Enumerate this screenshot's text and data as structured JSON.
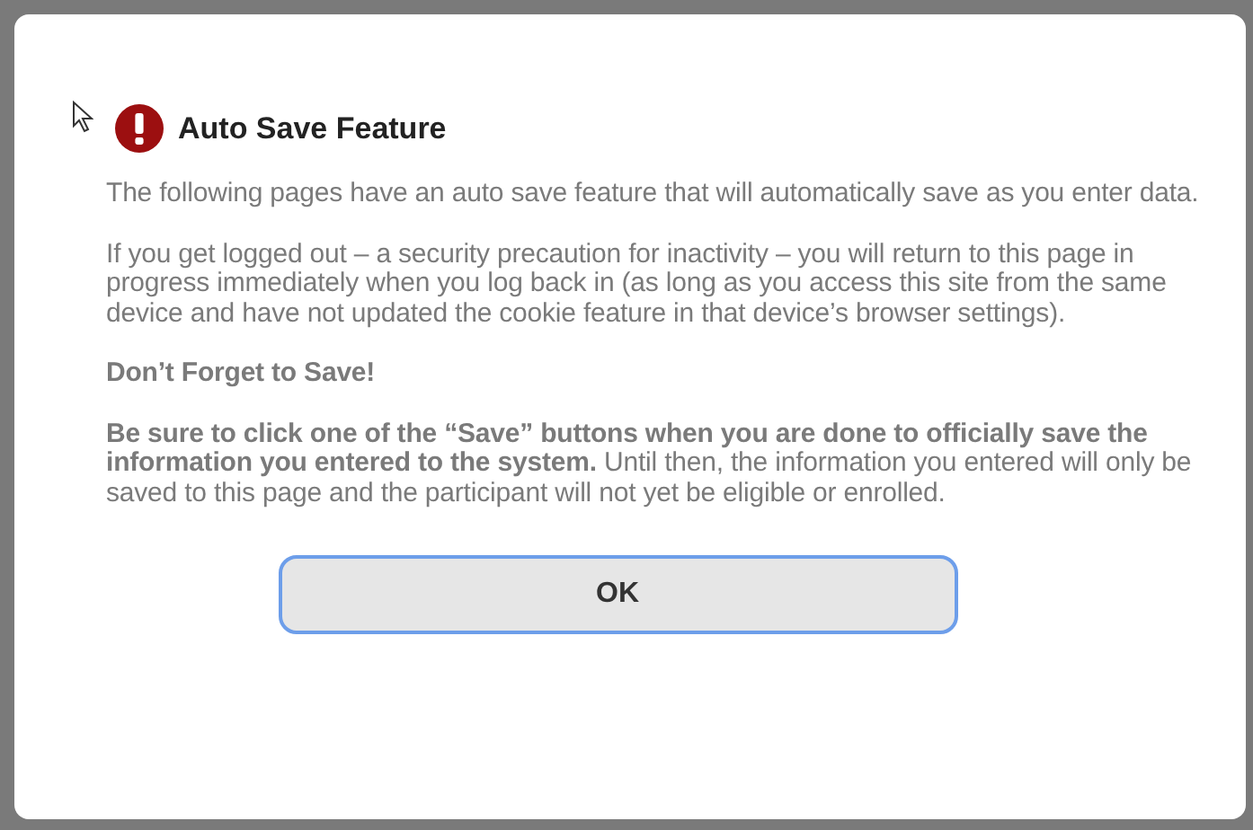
{
  "dialog": {
    "title": "Auto Save Feature",
    "paragraphs": [
      {
        "kind": "plain",
        "text": "The following pages have an auto save feature that will automatically save as you enter data."
      },
      {
        "kind": "plain",
        "text": "If you get logged out – a security precaution for inactivity – you will return to this page in progress immediately when you log back in (as long as you access this site from the same device and have not updated the cookie feature in that device’s browser settings)."
      },
      {
        "kind": "heading",
        "text": "Don’t Forget to Save!"
      },
      {
        "kind": "plain",
        "text": "**Be sure to click one of the “Save” buttons when you are done to officially save the information you entered to the system.** Until then, the information you entered will only be saved to this page and the participant will not yet be eligible or enrolled."
      }
    ],
    "button": {
      "label": "OK",
      "focused": true
    }
  }
}
